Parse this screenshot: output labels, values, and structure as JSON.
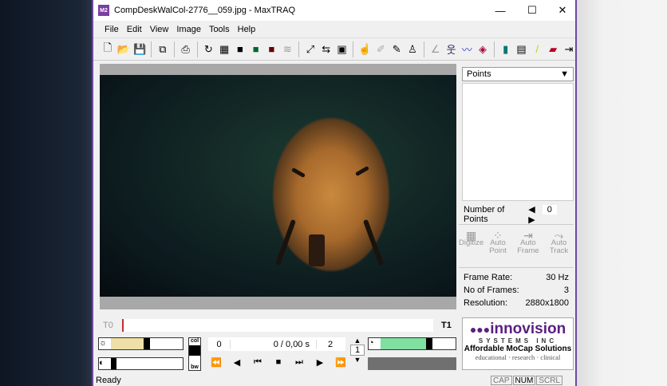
{
  "window": {
    "title": "CompDeskWalCol-2776__059.jpg - MaxTRAQ",
    "app_icon": "M2"
  },
  "menu": [
    "File",
    "Edit",
    "View",
    "Image",
    "Tools",
    "Help"
  ],
  "panel": {
    "dropdown": "Points",
    "num_points_label": "Number of Points",
    "num_points": "0",
    "tools": [
      {
        "label": "Digitize"
      },
      {
        "label": "Auto Point"
      },
      {
        "label": "Auto Frame"
      },
      {
        "label": "Auto Track"
      }
    ],
    "info": [
      {
        "k": "Frame Rate:",
        "v": "30 Hz"
      },
      {
        "k": "No of Frames:",
        "v": "3"
      },
      {
        "k": "Resolution:",
        "v": "2880x1800"
      }
    ]
  },
  "timeline": {
    "t0": "T0",
    "t1": "T1"
  },
  "playback": {
    "start": "0",
    "current": "0 /  0,00 s",
    "end": "2",
    "step": "1",
    "col": "col",
    "bw": "bw"
  },
  "logo": {
    "name": "innovision",
    "sub": "SYSTEMS INC",
    "tagline": "Affordable MoCap Solutions",
    "tags": "educational · research · clinical"
  },
  "status": {
    "text": "Ready",
    "cap": "CAP",
    "num": "NUM",
    "scrl": "SCRL"
  },
  "colors": {
    "accent": "#6b4aa0",
    "brightness": "#eedfa8",
    "speed": "#7fe0a0"
  }
}
